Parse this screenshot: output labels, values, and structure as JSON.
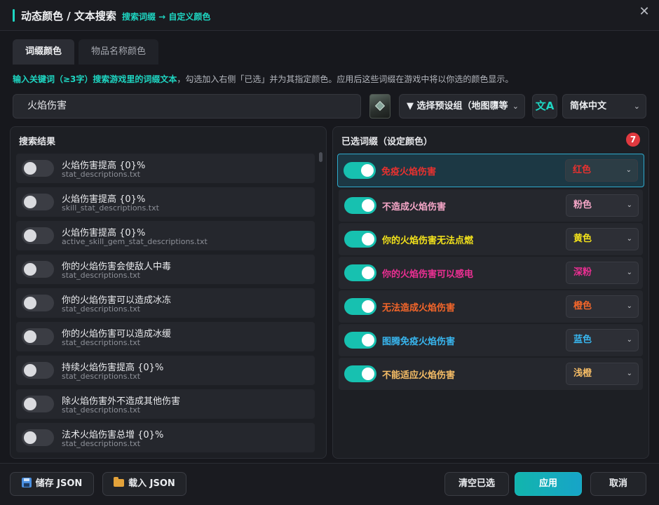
{
  "window": {
    "title": "动态颜色 / 文本搜索",
    "subtitle": "搜索词缀 → 自定义颜色",
    "close_glyph": "✕"
  },
  "tabs": [
    {
      "label": "词缀颜色",
      "active": true
    },
    {
      "label": "物品名称颜色",
      "active": false
    }
  ],
  "hint": {
    "highlight": "输入关键词（≥3字）搜索游戏里的词缀文本",
    "rest": "，勾选加入右侧「已选」并为其指定颜色。应用后这些词缀在游戏中将以你选的颜色显示。"
  },
  "search": {
    "value": "火焰伤害"
  },
  "toolbar": {
    "item_icon": "map-device-icon",
    "preset_label": "▼ 选择预设组（地图隳等",
    "translate_glyph": "文A",
    "language": "简体中文"
  },
  "results": {
    "title": "搜索结果",
    "items": [
      {
        "text": "火焰伤害提高 {0}%",
        "file": "stat_descriptions.txt",
        "on": false
      },
      {
        "text": "火焰伤害提高 {0}%",
        "file": "skill_stat_descriptions.txt",
        "on": false
      },
      {
        "text": "火焰伤害提高 {0}%",
        "file": "active_skill_gem_stat_descriptions.txt",
        "on": false
      },
      {
        "text": "你的火焰伤害会使敌人中毒",
        "file": "stat_descriptions.txt",
        "on": false
      },
      {
        "text": "你的火焰伤害可以造成冰冻",
        "file": "stat_descriptions.txt",
        "on": false
      },
      {
        "text": "你的火焰伤害可以造成冰缓",
        "file": "stat_descriptions.txt",
        "on": false
      },
      {
        "text": "持续火焰伤害提高 {0}%",
        "file": "stat_descriptions.txt",
        "on": false
      },
      {
        "text": "除火焰伤害外不造成其他伤害",
        "file": "stat_descriptions.txt",
        "on": false
      },
      {
        "text": "法术火焰伤害总增 {0}%",
        "file": "stat_descriptions.txt",
        "on": false
      }
    ]
  },
  "selected": {
    "title": "已选词缀（设定颜色）",
    "count": "7",
    "items": [
      {
        "text": "免疫火焰伤害",
        "color_name": "红色",
        "color": "#e8312f",
        "on": true
      },
      {
        "text": "不造成火焰伤害",
        "color_name": "粉色",
        "color": "#f6a7c8",
        "on": true
      },
      {
        "text": "你的火焰伤害无法点燃",
        "color_name": "黄色",
        "color": "#f3e21b",
        "on": true
      },
      {
        "text": "你的火焰伤害可以感电",
        "color_name": "深粉",
        "color": "#ec2f93",
        "on": true
      },
      {
        "text": "无法造成火焰伤害",
        "color_name": "橙色",
        "color": "#f4662a",
        "on": true
      },
      {
        "text": "图腾免疫火焰伤害",
        "color_name": "蓝色",
        "color": "#38b6ef",
        "on": true
      },
      {
        "text": "不能适应火焰伤害",
        "color_name": "浅橙",
        "color": "#f6bd66",
        "on": true
      }
    ]
  },
  "footer": {
    "save": "储存 JSON",
    "load": "载入 JSON",
    "clear": "清空已选",
    "apply": "应用",
    "cancel": "取消"
  },
  "colors": {
    "accent": "#1ed6c2",
    "badge": "#e0393f",
    "toggle_on": "#17c1b0"
  }
}
